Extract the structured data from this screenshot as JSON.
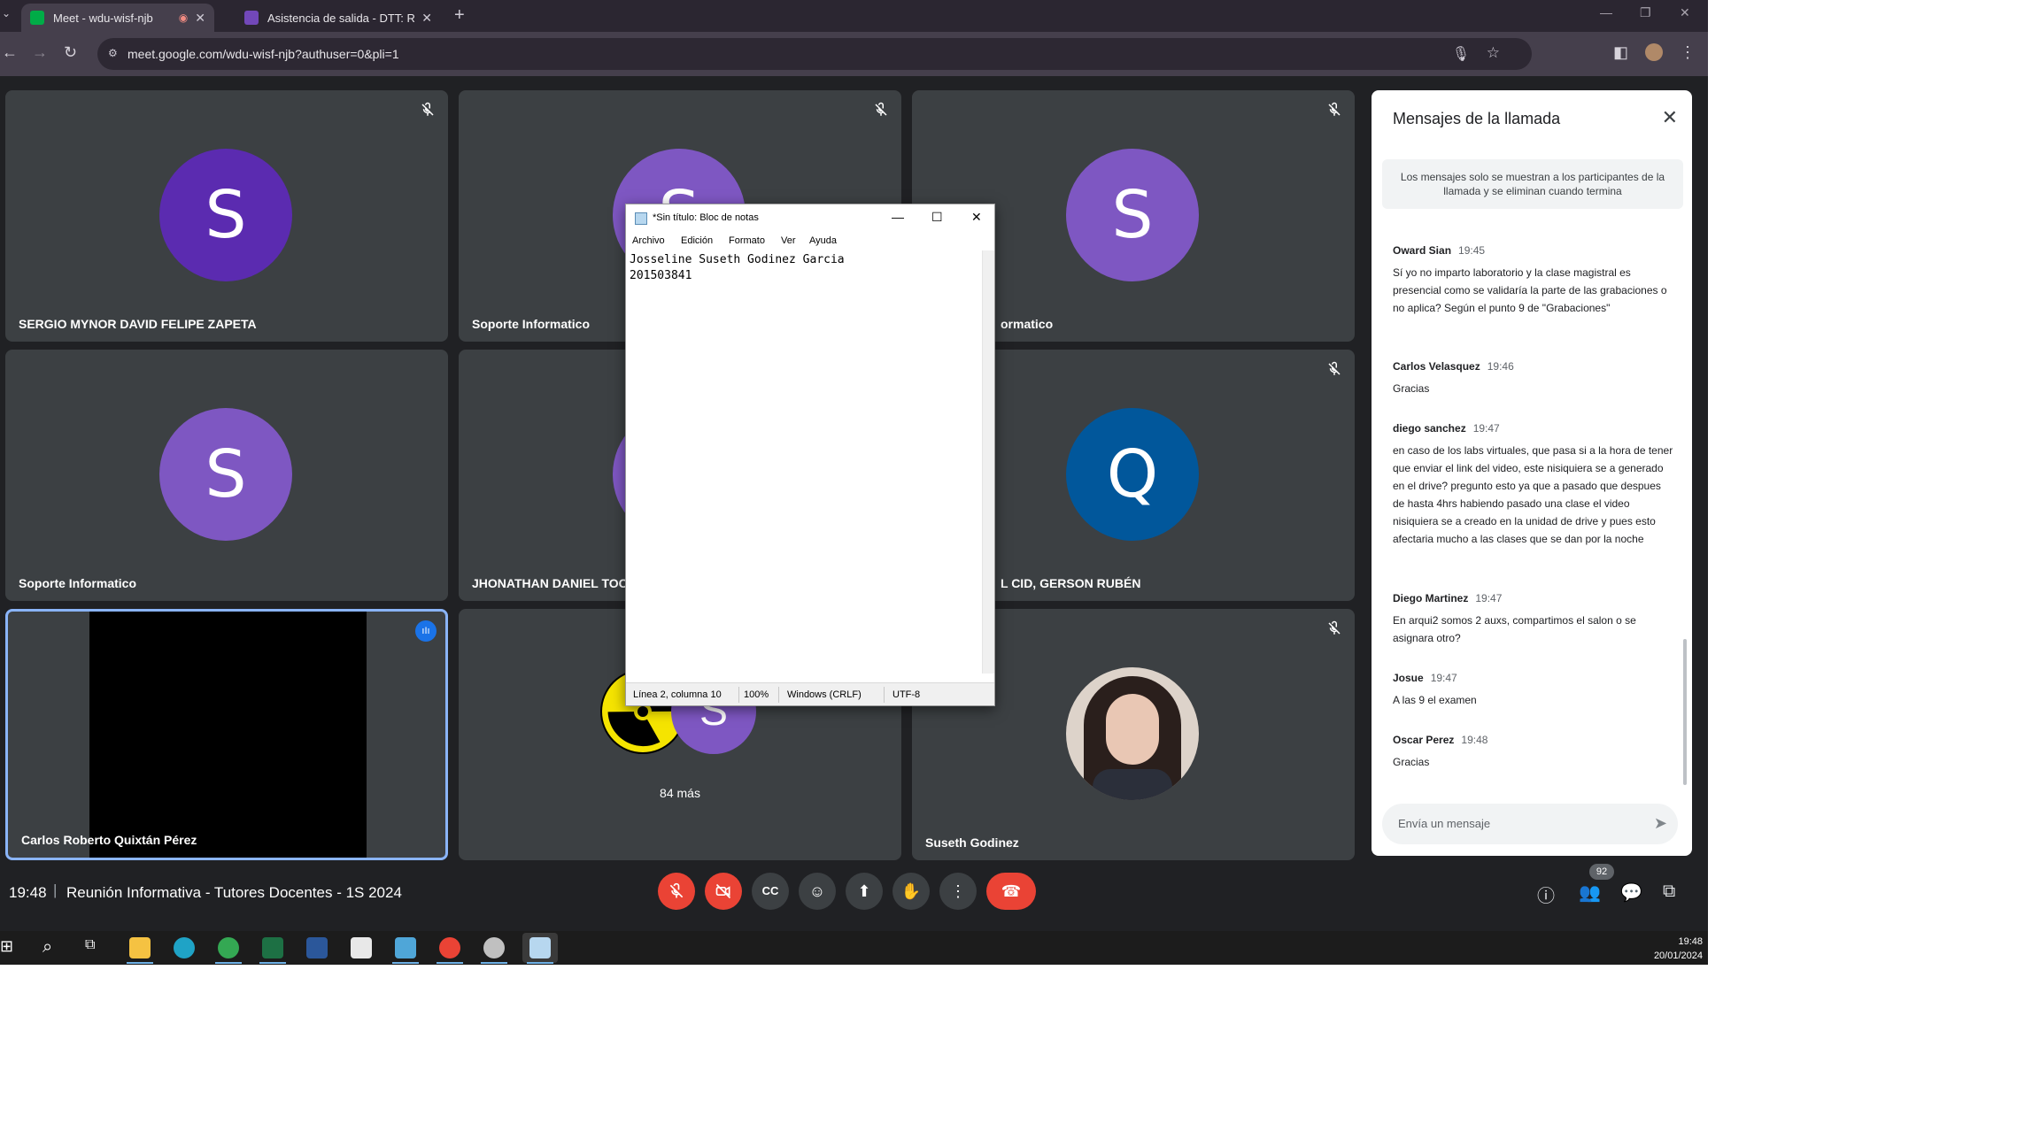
{
  "browser": {
    "tabs": [
      {
        "title": "Meet - wdu-wisf-njb",
        "active": true
      },
      {
        "title": "Asistencia de salida - DTT: Reun",
        "active": false
      }
    ],
    "url": "meet.google.com/wdu-wisf-njb?authuser=0&pli=1"
  },
  "participants": [
    {
      "name": "SERGIO MYNOR DAVID FELIPE ZAPETA",
      "initial": "S",
      "color": "#5b2bb0",
      "muted": true
    },
    {
      "name": "Soporte Informatico",
      "initial": "S",
      "color": "#7e57c2",
      "muted": true
    },
    {
      "name": "ormatico",
      "initial": "S",
      "color": "#7e57c2",
      "muted": true
    },
    {
      "name": "Soporte Informatico",
      "initial": "S",
      "color": "#7e57c2",
      "muted": false
    },
    {
      "name": "JHONATHAN DANIEL TOC",
      "initial": "",
      "color": "#7e57c2",
      "muted": false
    },
    {
      "name": "L CID, GERSON RUBÉN",
      "initial": "Q",
      "color": "#01579b",
      "muted": true
    },
    {
      "name": "Carlos Roberto Quixtán Pérez",
      "initial": "",
      "color": "#000000",
      "muted": false
    },
    {
      "name": "84 más",
      "initial": "S",
      "color": "#7e57c2",
      "muted": false
    },
    {
      "name": "Suseth Godinez",
      "initial": "",
      "color": "#e7d8cc",
      "muted": true
    }
  ],
  "chat": {
    "title": "Mensajes de la llamada",
    "note": "Los mensajes solo se muestran a los participantes de la llamada y se eliminan cuando termina",
    "messages": [
      {
        "sender": "Oward Sian",
        "time": "19:45",
        "text": "Sí yo no imparto laboratorio y la clase magistral es presencial como se validaría la parte de las grabaciones o no aplica? Según el punto 9 de \"Grabaciones\""
      },
      {
        "sender": "Carlos Velasquez",
        "time": "19:46",
        "text": "Gracias"
      },
      {
        "sender": "diego sanchez",
        "time": "19:47",
        "text": "en caso de los labs virtuales, que pasa si a la hora de tener que enviar el link del video, este nisiquiera se a generado en el drive? pregunto esto ya que a pasado que despues de hasta 4hrs habiendo pasado una clase el video nisiquiera se a creado en la unidad de drive y pues esto afectaria mucho a las clases que se dan por la noche"
      },
      {
        "sender": "Diego Martinez",
        "time": "19:47",
        "text": "En arqui2 somos 2 auxs, compartimos el salon o se asignara otro?"
      },
      {
        "sender": "Josue",
        "time": "19:47",
        "text": "A las 9 el examen"
      },
      {
        "sender": "Oscar Perez",
        "time": "19:48",
        "text": "Gracias"
      }
    ],
    "input_placeholder": "Envía un mensaje"
  },
  "meeting": {
    "clock": "19:48",
    "separator": "|",
    "title": "Reunión Informativa - Tutores Docentes - 1S 2024",
    "people_count": "92"
  },
  "notepad": {
    "title": "*Sin título: Bloc de notas",
    "menu": [
      "Archivo",
      "Edición",
      "Formato",
      "Ver",
      "Ayuda"
    ],
    "text": "Josseline Suseth Godinez Garcia\n201503841",
    "status": {
      "position": "Línea 2, columna 10",
      "zoom": "100%",
      "line_ending": "Windows (CRLF)",
      "encoding": "UTF-8"
    }
  },
  "taskbar": {
    "time": "19:48",
    "date": "20/01/2024"
  }
}
